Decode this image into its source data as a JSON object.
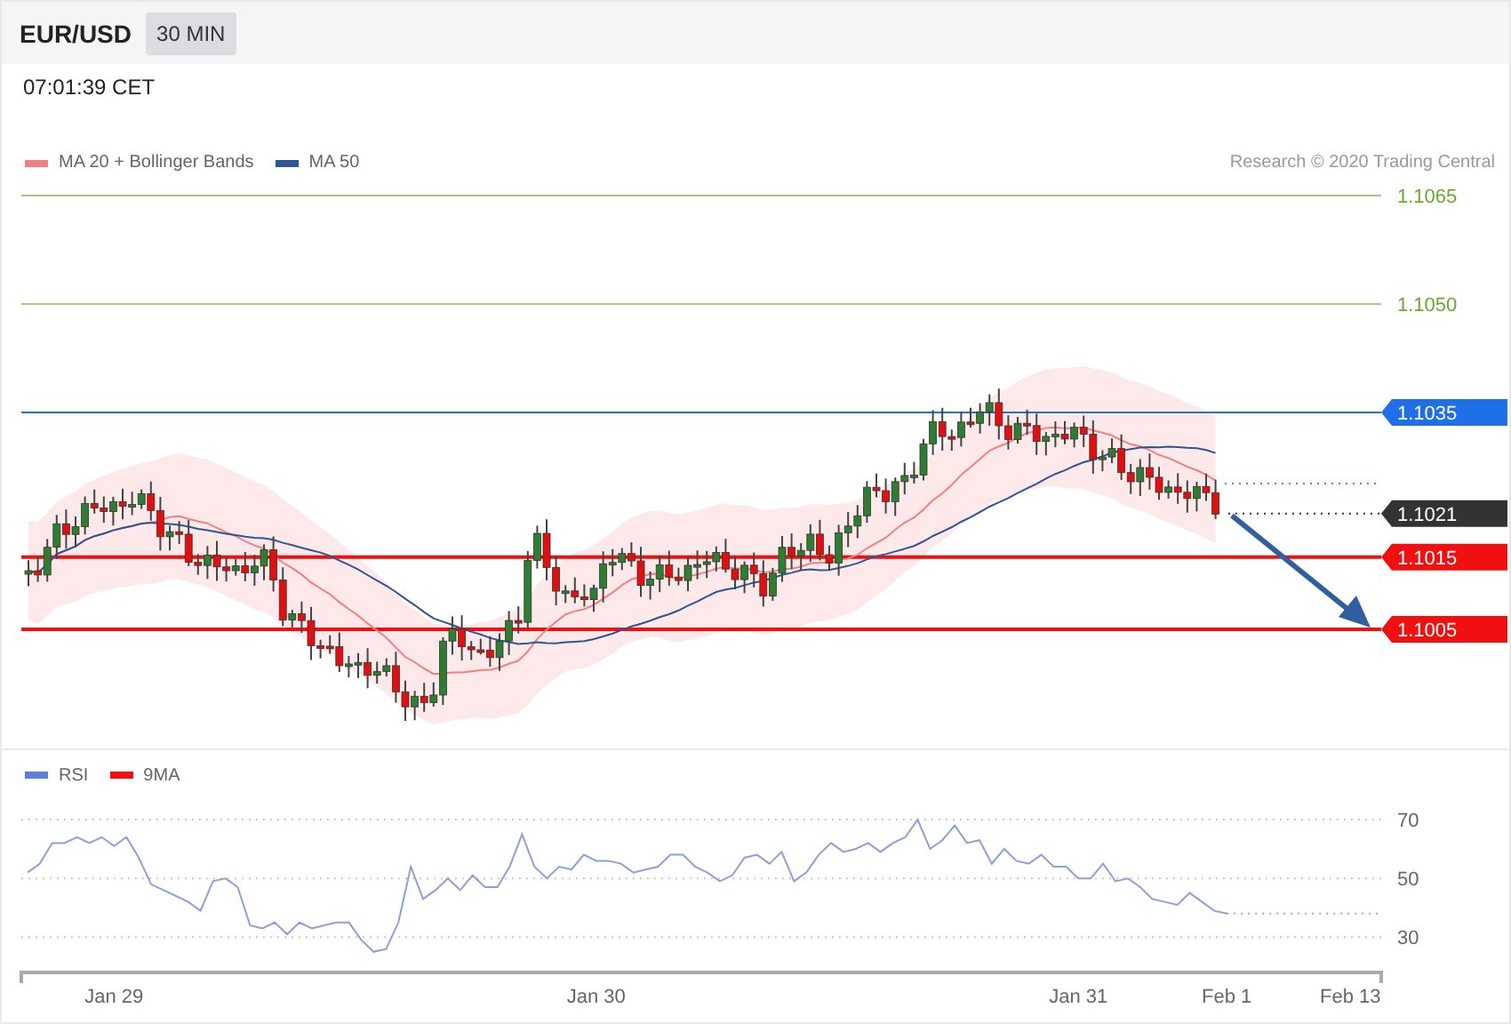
{
  "header": {
    "title": "EUR/USD",
    "timeframe": "30 MIN"
  },
  "timestamp": "07:01:39 CET",
  "legend": [
    {
      "label": "MA 20 + Bollinger Bands",
      "color": "#f28080"
    },
    {
      "label": "MA 50",
      "color": "#2f5597"
    }
  ],
  "credit": "Research © 2020 Trading Central",
  "levels": [
    {
      "label": "1.1065",
      "color": "#6aa832",
      "kind": "target"
    },
    {
      "label": "1.1050",
      "color": "#6aa832",
      "kind": "target"
    },
    {
      "label": "1.1035",
      "color": "#1f6fe8",
      "kind": "resistance"
    },
    {
      "label": "1.1021",
      "color": "#333333",
      "kind": "current"
    },
    {
      "label": "1.1015",
      "color": "#f01010",
      "kind": "support"
    },
    {
      "label": "1.1005",
      "color": "#f01010",
      "kind": "support"
    }
  ],
  "rsi_legend": [
    {
      "label": "RSI",
      "color": "#5b7fdc"
    },
    {
      "label": "9MA",
      "color": "#f01010"
    }
  ],
  "rsi": {
    "chart_data": {
      "type": "line",
      "grid": true,
      "ylim": [
        18,
        70
      ],
      "yticks": [
        30,
        50,
        70
      ],
      "categories": [
        null,
        null,
        null,
        null,
        null,
        null,
        null,
        "Jan 29",
        null,
        null,
        null,
        null,
        null,
        null,
        null,
        null,
        null,
        null,
        null,
        null,
        null,
        null,
        null,
        null,
        null,
        null,
        null,
        null,
        null,
        null,
        null,
        null,
        null,
        null,
        null,
        null,
        null,
        null,
        null,
        null,
        null,
        null,
        null,
        null,
        null,
        null,
        "Jan 30",
        null,
        null,
        null,
        null,
        null,
        null,
        null,
        null,
        null,
        null,
        null,
        null,
        null,
        null,
        null,
        null,
        null,
        null,
        null,
        null,
        null,
        null,
        null,
        null,
        null,
        null,
        null,
        null,
        null,
        null,
        null,
        null,
        null,
        null,
        null,
        null,
        null,
        null,
        "Jan 31",
        null,
        null,
        null,
        null,
        null,
        null,
        null,
        null,
        null,
        null,
        null,
        "Feb 1",
        null,
        null,
        null,
        null,
        null,
        null,
        null,
        null,
        null,
        "Feb 13"
      ],
      "series": [
        {
          "color": "#8f9fd8",
          "values": [
            52,
            55,
            62,
            62,
            64,
            62,
            64,
            61,
            64,
            57,
            48,
            46,
            44,
            42,
            39,
            49,
            50,
            47,
            34,
            33,
            35,
            31,
            35,
            33,
            34,
            35,
            35,
            29,
            25,
            26,
            35,
            54,
            43,
            46,
            50,
            46,
            51,
            47,
            47,
            54,
            65,
            54,
            50,
            54,
            53,
            58,
            56,
            56,
            55,
            52,
            53,
            54,
            58,
            58,
            54,
            52,
            49,
            51,
            57,
            58,
            55,
            59,
            49,
            52,
            58,
            62,
            59,
            60,
            62,
            59,
            62,
            64,
            70,
            60,
            63,
            68,
            62,
            63,
            55,
            60,
            56,
            55,
            58,
            54,
            54,
            50,
            50,
            55,
            49,
            50,
            47,
            43,
            42,
            41,
            45,
            42,
            39,
            38,
            null,
            null,
            null,
            null,
            null,
            null,
            null,
            null,
            null,
            null
          ]
        }
      ]
    }
  }
}
